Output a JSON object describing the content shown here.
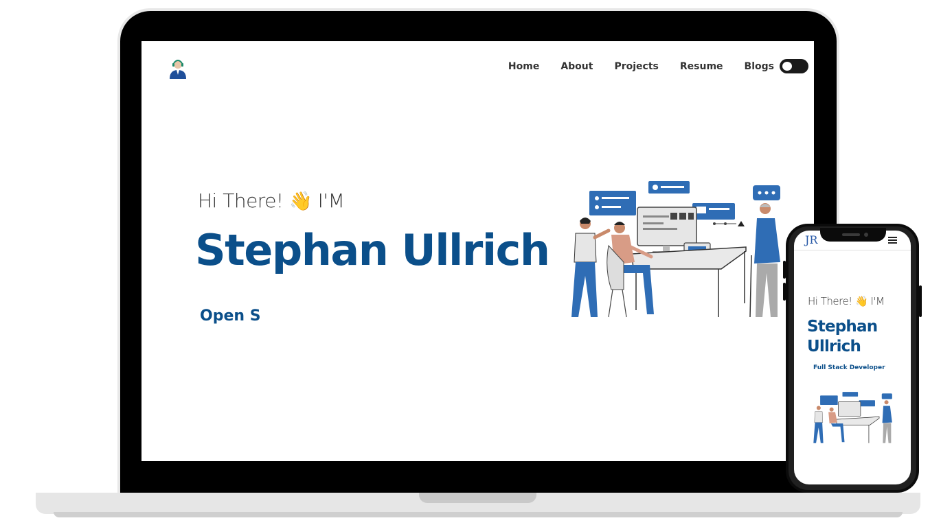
{
  "nav": {
    "items": [
      "Home",
      "About",
      "Projects",
      "Resume",
      "Blogs"
    ]
  },
  "hero": {
    "greeting_prefix": "Hi There!",
    "wave_emoji": "👋",
    "greeting_suffix": "I'M",
    "name": "Stephan Ullrich",
    "typed_text": "Open S"
  },
  "phone": {
    "logo": "JR",
    "greeting_prefix": "Hi There!",
    "wave_emoji": "👋",
    "greeting_suffix": "I'M",
    "name": "Stephan Ullrich",
    "role": "Full Stack Developer"
  },
  "colors": {
    "brand": "#0b4f8a",
    "accent": "#2f6db5"
  },
  "icons": {
    "site_logo": "avatar-headset-icon",
    "theme_toggle": "toggle-icon",
    "menu": "hamburger-menu-icon"
  }
}
